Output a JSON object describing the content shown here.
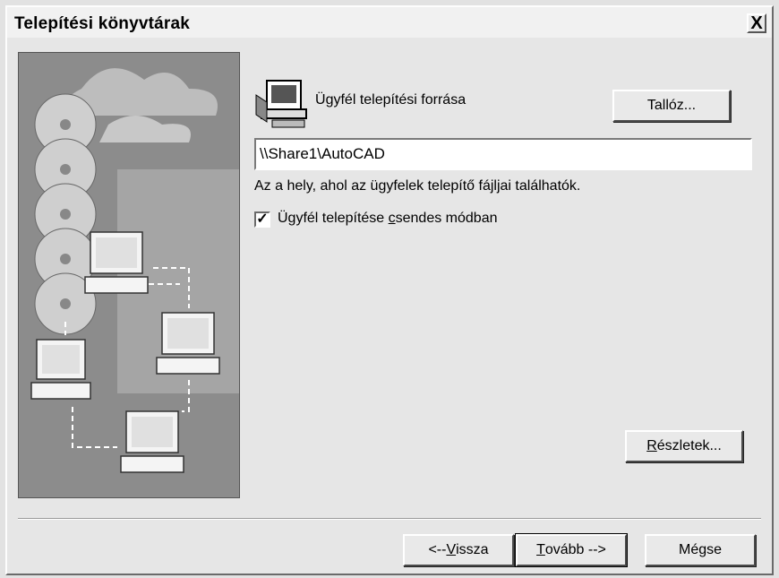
{
  "dialog": {
    "title": "Telepítési könyvtárak",
    "close_label": "X"
  },
  "source": {
    "label_pre": "Ü",
    "label_ul": "g",
    "label_post": "yfél telepítési forrása",
    "browse_button": "Tallóz...",
    "path_value": "\\\\Share1\\AutoCAD",
    "description": "Az a hely, ahol az ügyfelek telepítő fájljai találhatók."
  },
  "silent_install": {
    "checked": true,
    "check_mark": "✓",
    "label_pre": "Ügyfél telepítése ",
    "label_ul": "c",
    "label_post": "sendes módban"
  },
  "details_button": {
    "pre": "",
    "ul": "R",
    "post": "észletek..."
  },
  "nav": {
    "back": {
      "pre": "<--",
      "ul": "V",
      "post": "issza"
    },
    "next": {
      "pre": "",
      "ul": "T",
      "post": "ovább -->"
    },
    "cancel": "Mégse"
  },
  "colors": {
    "dialog_bg": "#e6e6e6",
    "illustration_bg": "#8f8f8f"
  }
}
